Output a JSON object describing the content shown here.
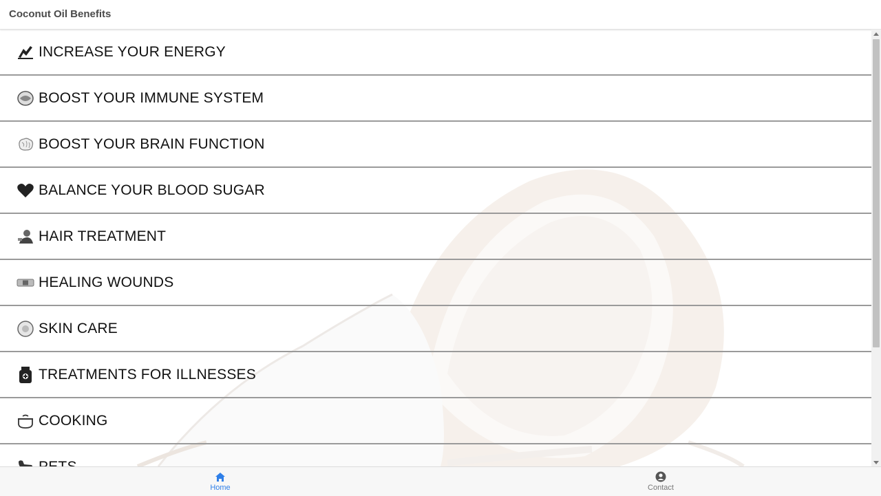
{
  "app": {
    "title": "Coconut Oil Benefits"
  },
  "menu": {
    "items": [
      {
        "label": "INCREASE YOUR ENERGY",
        "icon": "energy-icon"
      },
      {
        "label": "BOOST YOUR IMMUNE SYSTEM",
        "icon": "immune-system-icon"
      },
      {
        "label": "BOOST YOUR BRAIN FUNCTION",
        "icon": "brain-icon"
      },
      {
        "label": "BALANCE YOUR BLOOD SUGAR",
        "icon": "heart-icon"
      },
      {
        "label": "HAIR TREATMENT",
        "icon": "hair-treatment-icon"
      },
      {
        "label": "HEALING WOUNDS",
        "icon": "bandage-icon"
      },
      {
        "label": "SKIN CARE",
        "icon": "skin-care-icon"
      },
      {
        "label": "TREATMENTS FOR ILLNESSES",
        "icon": "medicine-bottle-icon"
      },
      {
        "label": "COOKING",
        "icon": "cooking-pot-icon"
      },
      {
        "label": "PETS",
        "icon": "pet-dog-icon"
      }
    ]
  },
  "bottom_nav": {
    "home_label": "Home",
    "contact_label": "Contact",
    "active": "Home"
  },
  "colors": {
    "accent": "#2f7fe8",
    "inactive": "#777777",
    "divider": "#9a9a9a"
  }
}
